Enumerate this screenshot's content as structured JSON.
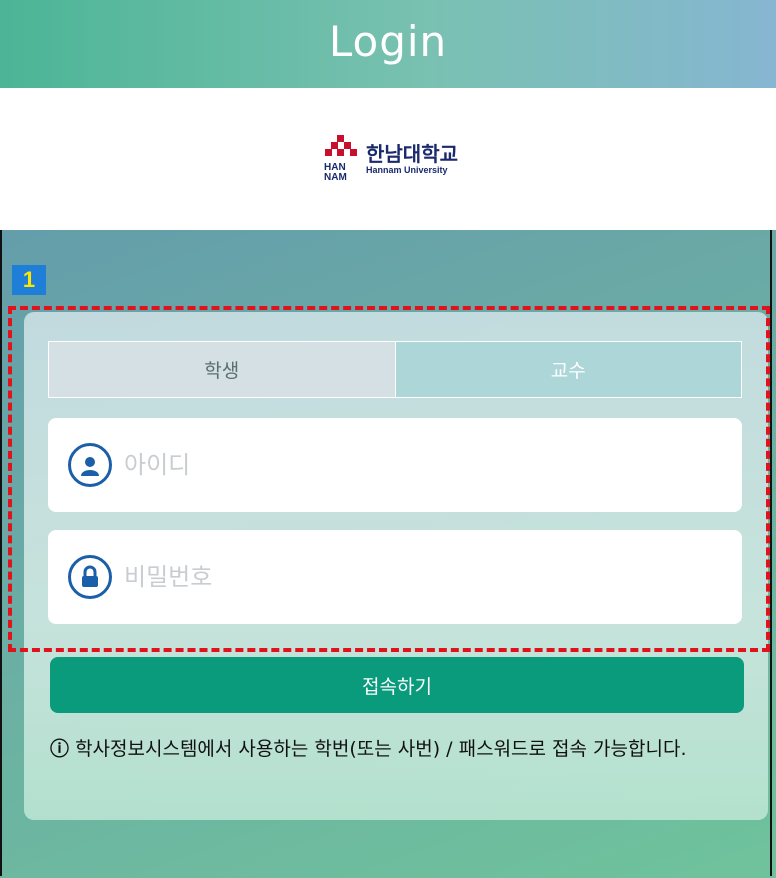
{
  "header": {
    "title": "Login"
  },
  "logo": {
    "korean_name": "한남대학교",
    "english_name": "Hannam University",
    "mark_text": "HAN\nNAM"
  },
  "annotation": {
    "badge_number": "1"
  },
  "tabs": [
    {
      "label": "학생",
      "active": true
    },
    {
      "label": "교수",
      "active": false
    }
  ],
  "form": {
    "id_placeholder": "아이디",
    "id_value": "",
    "password_placeholder": "비밀번호",
    "password_value": "",
    "submit_label": "접속하기"
  },
  "notice": {
    "icon": "ⓘ",
    "text": "학사정보시스템에서 사용하는 학번(또는 사번) / 패스워드로 접속 가능합니다."
  },
  "colors": {
    "accent": "#0a9a7c",
    "icon_blue": "#1b5fa8",
    "annotation_red": "#e0121b",
    "badge_blue": "#1f7fd8"
  }
}
